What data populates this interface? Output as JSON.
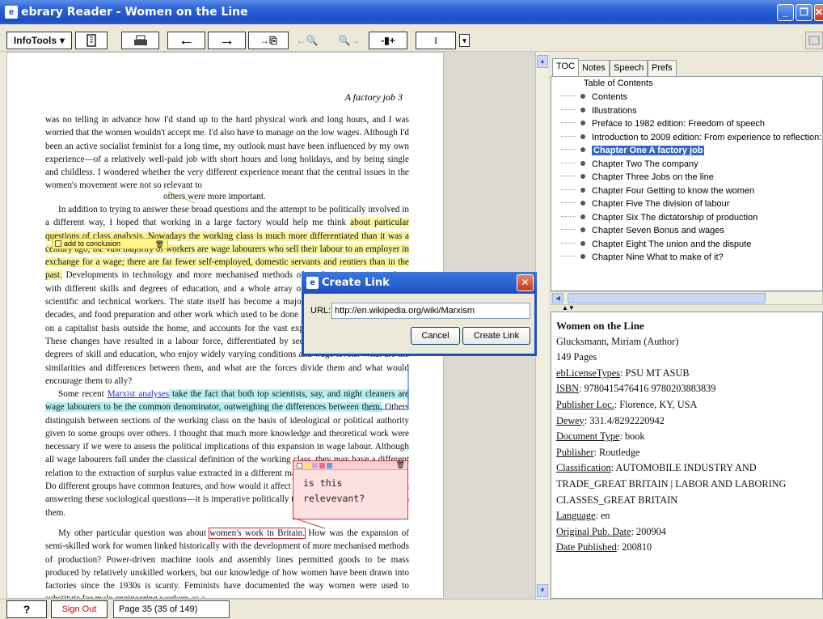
{
  "window": {
    "title": "ebrary Reader - Women on the Line",
    "minimize": "_",
    "restore": "❐",
    "close": "✕"
  },
  "toolbar": {
    "infotools": "InfoTools",
    "drop": "▾",
    "bookmark_icon": "bookmarks-icon",
    "print_icon": "print-icon",
    "arrow_left": "←",
    "arrow_right": "→",
    "copy_arrow": "→⎘",
    "prev_hit": "←🔍",
    "next_hit": "🔍→",
    "add_page": "-▮+",
    "text_cursor": "I"
  },
  "document": {
    "running_head": "A factory job   3",
    "p1": "was no telling in advance how I'd stand up to the hard physical work and long hours, and I was worried that the women wouldn't accept me. I'd also have to manage on the low wages. Although I'd been an active socialist feminist for a long time, my outlook must have been influenced by my own experience—of a relatively well-paid job with short hours and long holidays, and by being single and childless. I wondered whether the very different experience meant that the central issues in the women's movement were not so relevant to",
    "p1_tail": "others were more important.",
    "p2a": "In addition to trying to answer these broad questions and the attempt to be politically involved in a different way, I hoped that working in a large factory would help me think ",
    "p2_hl1": "about particular questions of class analysis. Nowadays the working class is much more differentiated than it was a century ago; the vast majority of workers are wage labourers who sell their labour to an employer in exchange for a wage; there are far fewer self-employed, domestic servants and rentiers than in the past.",
    "p2b": " Developments in technology and more mechanised methods of production require workers with different skills and degrees of education, and a whole array of white-collar administrative, scientific and technical workers. The state itself has become a major employer over the last few decades, and food preparation and other work which used to be done in the home is now organised on a capitalist basis outside the home, and accounts for the vast expansion of the service sector. These changes have resulted in a labour force, differentiated by sector and divided by different degrees of skill and education, who enjoy widely varying conditions and wage levels. What are the similarities and differences between them, and what are the forces divide them and what would encourage them to ally?",
    "p3a": "Some recent ",
    "p3_link": "Marxist analyses",
    "p3_hl": " take the fact that both top scientists, say, and night cleaners are wage labourers to be the common denominator, outweighing the differences between them.",
    "p3b": " Others distinguish between sections of the working class on the basis of ideological or political authority given to some groups over others. I thought that much more knowledge and theoretical work were necessary if we were to assess the political implications of this expansion in wage labour. Although all wage labourers fall under the classical definition of the working class, they may have a different relation to the extraction of surplus value extracted in a different manner from the different groups. Do different groups have common features, and how would it affect their political consciousness? In answering these sociological questions—it is imperative politically to know what unites and divides them.",
    "p4a": "My other particular question was about ",
    "p4_hl": "women's work in Britain.",
    "p4b": " How was the expansion of semi-skilled work for women linked historically with the development of more mechanised methods of production? Power-driven machine tools and assembly lines permitted goods to be mass produced by relatively unskilled workers, but our knowledge of how women have been drawn into factories since the 1930s is scanty. Feminists have documented the way women were used to substitute for male engineering workers as a",
    "note_tag": "add to conclusion",
    "sticky_note": "is this relevevant?"
  },
  "dialog": {
    "title": "Create Link",
    "url_label": "URL:",
    "url_value": "http://en.wikipedia.org/wiki/Marxism",
    "cancel": "Cancel",
    "create": "Create Link",
    "close": "✕"
  },
  "tabs": [
    "TOC",
    "Notes",
    "Speech",
    "Prefs"
  ],
  "toc": {
    "header": "Table of Contents",
    "items": [
      "Contents",
      "Illustrations",
      "Preface to 1982 edition: Freedom of speech",
      "Introduction to 2009 edition: From experience to reflection: c",
      "Chapter One A factory job",
      "Chapter Two The company",
      "Chapter Three Jobs on the line",
      "Chapter Four Getting to know the women",
      "Chapter Five The division of labour",
      "Chapter Six The dictatorship of production",
      "Chapter Seven Bonus and wages",
      "Chapter Eight The union and the dispute",
      "Chapter Nine What to make of it?"
    ],
    "selected_index": 4
  },
  "info": {
    "book_title": "Women on the Line",
    "author": "Glucksmann, Miriam (Author)",
    "pages": "149 Pages",
    "license_k": "ebLicenseTypes",
    "license_v": ": PSU MT ASUB",
    "isbn_k": "ISBN",
    "isbn_v": ": 9780415476416 9780203883839",
    "publoc_k": "Publisher Loc.",
    "publoc_v": ": Florence, KY, USA",
    "dewey_k": "Dewey",
    "dewey_v": ": 331.4/8292220942",
    "doctype_k": "Document Type",
    "doctype_v": ": book",
    "publisher_k": "Publisher",
    "publisher_v": ": Routledge",
    "class_k": "Classification",
    "class_v": ": AUTOMOBILE INDUSTRY AND TRADE_GREAT BRITAIN | LABOR AND LABORING CLASSES_GREAT BRITAIN",
    "lang_k": "Language",
    "lang_v": ": en",
    "orig_k": "Original Pub. Date",
    "orig_v": ": 200904",
    "datepub_k": "Date Published",
    "datepub_v": ": 200810"
  },
  "status": {
    "help": "?",
    "signout": "Sign Out",
    "page": "Page 35 (35 of 149)"
  }
}
